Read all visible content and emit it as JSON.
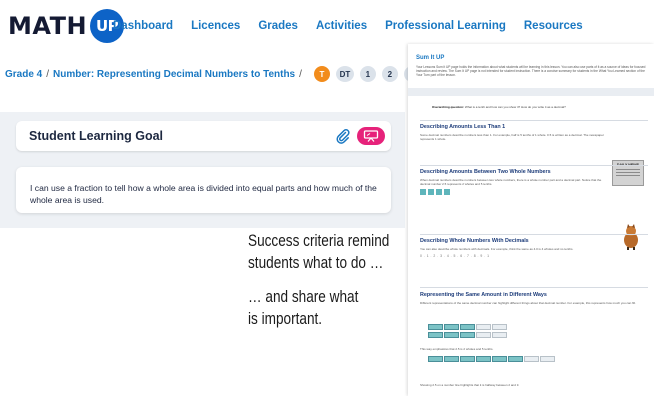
{
  "logo": {
    "text_math": "MATH",
    "text_up": "UP"
  },
  "colors": {
    "brand_blue": "#0d63c7",
    "link_blue": "#1a78c2",
    "accent_orange": "#f28c1c",
    "present_pink": "#e6227a"
  },
  "nav": {
    "items": [
      "Dashboard",
      "Licences",
      "Grades",
      "Activities",
      "Professional Learning",
      "Resources"
    ]
  },
  "breadcrumb": {
    "grade": "Grade 4",
    "separator": "/",
    "current": "Number: Representing Decimal Numbers to Tenths",
    "trailing_separator": "/",
    "pills": [
      "T",
      "DT",
      "1",
      "2",
      "3",
      "AL"
    ],
    "active_pill": "T"
  },
  "goal": {
    "title": "Student Learning Goal",
    "text": "I can use a fraction to tell how a whole area is divided into equal parts and how much of the whole area is used.",
    "icons": [
      "paperclip-icon",
      "presentation-icon"
    ]
  },
  "caption": {
    "line1": "Success criteria remind",
    "line2": "students what to do …",
    "line3": "… and share what",
    "line4": "is important."
  },
  "doc": {
    "title": "Sum It UP",
    "intro": "Your Lessons Sum it UP page holds the information about what students will be learning in this lesson. You can also use parts of it as a source of ideas for focused instruction and review. The Sum It UP page is not intended for student instruction. There is a concise summary for students in the What You Learned section of the Your Turn part of the lesson.",
    "purpose_label": "Overarching question:",
    "purpose_text": "What is a tenth and how can you show it? How do you write it as a decimal?",
    "sections": [
      {
        "heading": "Describing Amounts Less Than 1",
        "text": "Some decimal numbers describe numbers less than 1. For example, half is 5 tenths of 1 whole. 0.5 is written as a decimal. The newspaper represents 1 whole."
      },
      {
        "heading": "Describing Amounts Between Two Whole Numbers",
        "text": "When decimal numbers describe numbers between two whole numbers, there is a whole number part and a decimal part. Notice that the decimal number 2.5 represents 2 wholes and 5 tenths."
      },
      {
        "heading": "Describing Whole Numbers With Decimals",
        "text": "You can also describe whole numbers with decimals. For example, think the same as 4.0 is 4 wholes and no tenths."
      },
      {
        "heading": "Representing the Same Amount in Different Ways",
        "text": "Different representations of the same decimal number can highlight different things about that decimal number. For example, this represents how much you can fill."
      }
    ],
    "newspaper_label": "DAILY NEWS",
    "dots": "0 . 1 . 2 . 3 . 4 . 5 . 6 . 7 . 8 . 9 . 1",
    "table_note_1": "This way emphasizes that 2.5 is 2 wholes and 5 tenths.",
    "table_note_2": "Showing 2.5 on a number line highlights that it is halfway between 2 and 3."
  }
}
